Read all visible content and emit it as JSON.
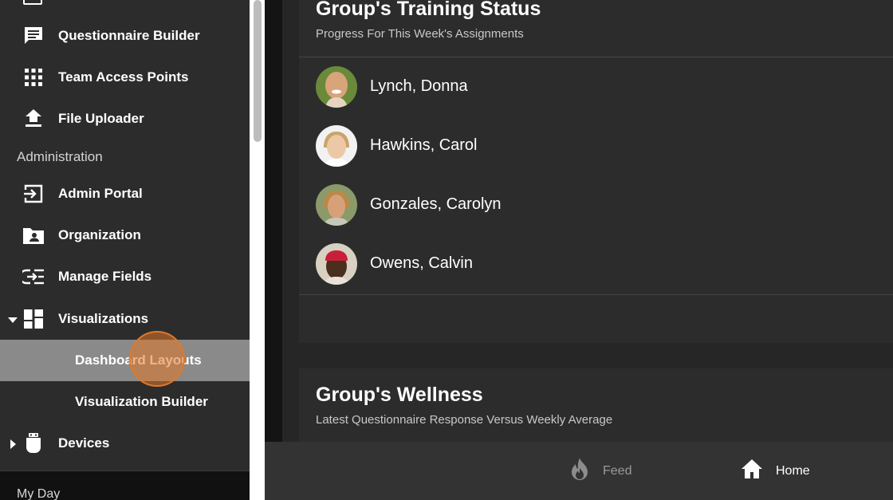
{
  "sidebar": {
    "items": [
      {
        "label": "Questionnaire Builder"
      },
      {
        "label": "Team Access Points"
      },
      {
        "label": "File Uploader"
      },
      {
        "label": "Admin Portal"
      },
      {
        "label": "Organization"
      },
      {
        "label": "Manage Fields"
      },
      {
        "label": "Visualizations"
      },
      {
        "label": "Dashboard Layouts"
      },
      {
        "label": "Visualization Builder"
      },
      {
        "label": "Devices"
      }
    ],
    "section_administration": "Administration",
    "footer": "My Day"
  },
  "training_card": {
    "title": "Group's Training Status",
    "subtitle": "Progress For This Week's Assignments",
    "athletes": [
      {
        "name": "Lynch, Donna"
      },
      {
        "name": "Hawkins, Carol"
      },
      {
        "name": "Gonzales, Carolyn"
      },
      {
        "name": "Owens, Calvin"
      }
    ]
  },
  "wellness_card": {
    "title": "Group's Wellness",
    "subtitle": "Latest Questionnaire Response Versus Weekly Average"
  },
  "bottom_nav": {
    "feed_label": "Feed",
    "home_label": "Home"
  },
  "colors": {
    "sidebar_bg": "#2c2c2c",
    "active_item_bg": "#8a8a8a",
    "ripple_accent": "#e0782a",
    "card_bg": "#2c2c2c"
  },
  "icons": [
    "chat-icon",
    "grid-icon",
    "upload-icon",
    "login-icon",
    "folder-user-icon",
    "manage-fields-icon",
    "dashboard-icon",
    "device-icon",
    "fire-icon",
    "home-icon"
  ]
}
